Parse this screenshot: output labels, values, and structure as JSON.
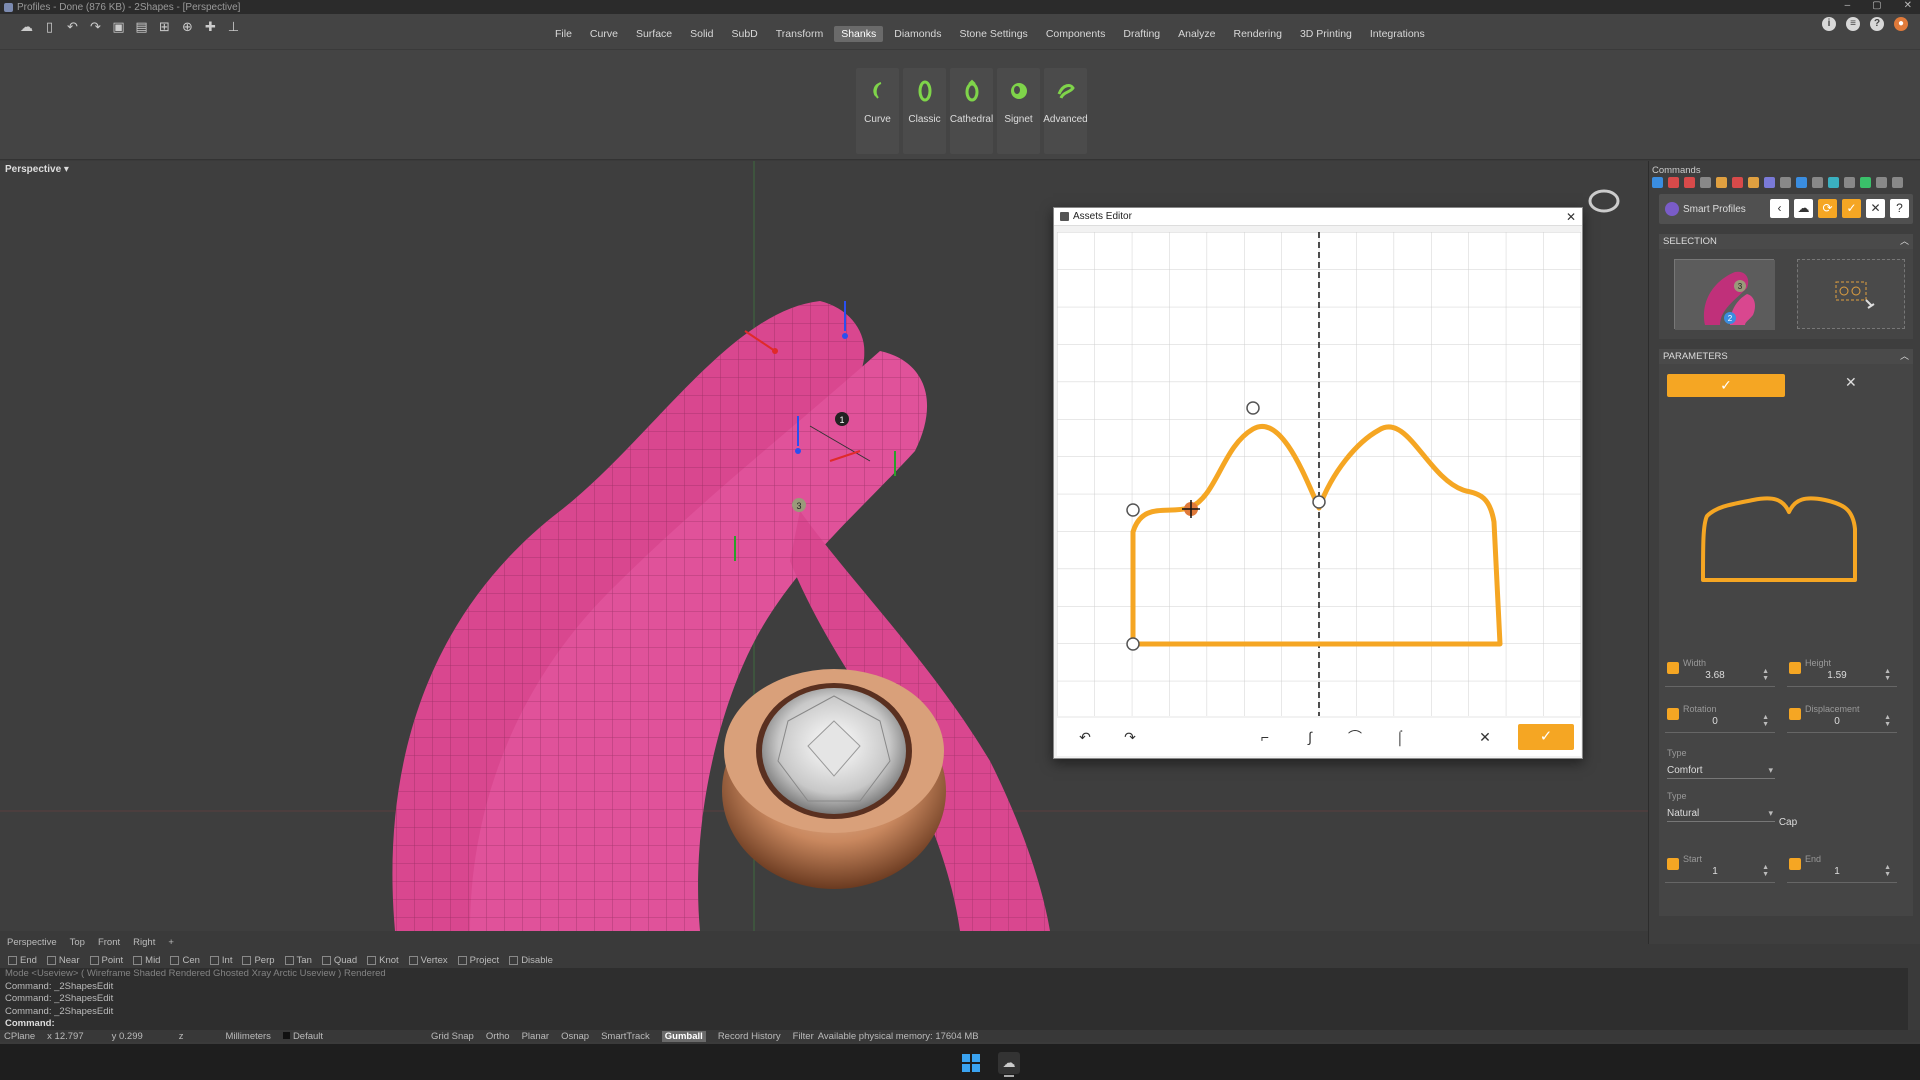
{
  "window": {
    "title": "Profiles - Done (876 KB) - 2Shapes - [Perspective]",
    "controls": [
      "–",
      "▢",
      "✕"
    ]
  },
  "menu": [
    {
      "label": "File",
      "active": false
    },
    {
      "label": "Curve",
      "active": false
    },
    {
      "label": "Surface",
      "active": false
    },
    {
      "label": "Solid",
      "active": false
    },
    {
      "label": "SubD",
      "active": false
    },
    {
      "label": "Transform",
      "active": false
    },
    {
      "label": "Shanks",
      "active": true
    },
    {
      "label": "Diamonds",
      "active": false
    },
    {
      "label": "Stone Settings",
      "active": false
    },
    {
      "label": "Components",
      "active": false
    },
    {
      "label": "Drafting",
      "active": false
    },
    {
      "label": "Analyze",
      "active": false
    },
    {
      "label": "Rendering",
      "active": false
    },
    {
      "label": "3D Printing",
      "active": false
    },
    {
      "label": "Integrations",
      "active": false
    }
  ],
  "ribbon": [
    {
      "label": "Curve",
      "icon": "curve-shank-icon"
    },
    {
      "label": "Classic",
      "icon": "classic-shank-icon"
    },
    {
      "label": "Cathedral",
      "icon": "cathedral-shank-icon"
    },
    {
      "label": "Signet",
      "icon": "signet-shank-icon"
    },
    {
      "label": "Advanced",
      "icon": "advanced-shank-icon"
    }
  ],
  "viewport": {
    "label": "Perspective ▾",
    "tabs": [
      "Perspective",
      "Top",
      "Front",
      "Right",
      "+"
    ],
    "markers": [
      "1",
      "3"
    ]
  },
  "assets_editor": {
    "title": "Assets Editor",
    "close": "✕",
    "ok": "✓",
    "cancel": "✕",
    "undo": "↶",
    "redo": "↷"
  },
  "osnap": [
    "End",
    "Near",
    "Point",
    "Mid",
    "Cen",
    "Int",
    "Perp",
    "Tan",
    "Quad",
    "Knot",
    "Vertex",
    "Project",
    "Disable"
  ],
  "command_history": [
    "Mode <Useview> ( Wireframe  Shaded  Rendered  Ghosted  Xray  Arctic  Useview )  Rendered",
    "Command: _2ShapesEdit",
    "Command: _2ShapesEdit",
    "Command: _2ShapesEdit"
  ],
  "command_prompt": "Command:",
  "status": {
    "cplane": "CPlane",
    "x": "x 12.797",
    "y": "y 0.299",
    "z": "z",
    "units": "Millimeters",
    "layer": "Default",
    "toggles": [
      "Grid Snap",
      "Ortho",
      "Planar",
      "Osnap",
      "SmartTrack"
    ],
    "gumball": "Gumball",
    "record": "Record History",
    "filter": "Filter",
    "memory": "Available physical memory: 17604 MB"
  },
  "panel": {
    "header": "Commands",
    "plugin": "Smart Profiles",
    "selection_title": "SELECTION",
    "parameters_title": "PARAMETERS",
    "selection_markers": [
      "3",
      "2"
    ],
    "ok": "✓",
    "cancel": "✕",
    "width": {
      "label": "Width",
      "value": "3.68"
    },
    "height": {
      "label": "Height",
      "value": "1.59"
    },
    "rotation": {
      "label": "Rotation",
      "value": "0"
    },
    "displacement": {
      "label": "Displacement",
      "value": "0"
    },
    "type1": {
      "label": "Type",
      "value": "Comfort"
    },
    "type2": {
      "label": "Type",
      "value": "Natural"
    },
    "cap_label": "Cap",
    "start": {
      "label": "Start",
      "value": "1"
    },
    "end": {
      "label": "End",
      "value": "1"
    }
  },
  "colors": {
    "accent": "#f5a623",
    "ring": "#d9478f",
    "gold": "#c9885f"
  }
}
